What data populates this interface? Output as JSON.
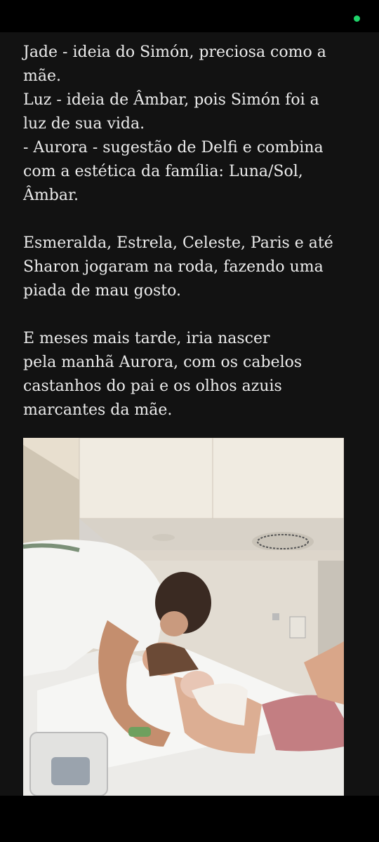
{
  "story": {
    "lines": [
      "Jade - ideia do Simón, preciosa como a",
      "mãe.",
      "Luz - ideia de Âmbar, pois Simón foi a",
      "luz de sua vida.",
      "- Aurora - sugestão de Delfi e combina",
      "com a estética da família: Luna/Sol,",
      "Âmbar.",
      "",
      "Esmeralda, Estrela, Celeste, Paris e até",
      "Sharon jogaram na roda, fazendo uma",
      "piada de mau gosto.",
      "",
      "E meses mais tarde, iria nascer",
      "pela manhã Aurora, com os cabelos",
      "castanhos do pai e os olhos azuis",
      "marcantes da mãe."
    ]
  },
  "colors": {
    "background": "#121212",
    "text": "#ececec",
    "status_dot": "#1fd46a"
  },
  "photo": {
    "icon": "hospital-photo-icon"
  }
}
